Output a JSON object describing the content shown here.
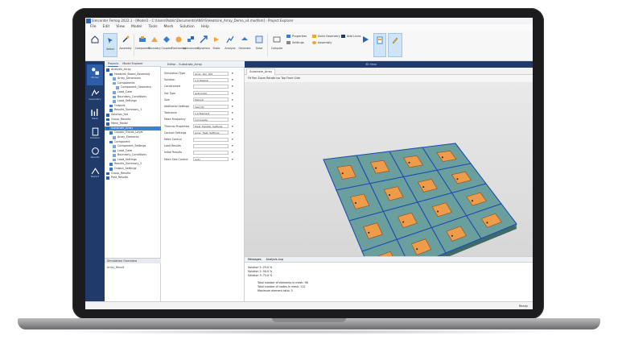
{
  "app": {
    "title": "Simcenter Femap 2022.1 - [Model1 - C:\\Users\\Public\\Documents\\ANSYS\\Heatsink_Array_Demo_v4.modfem] - Project Explorer",
    "menu": [
      "File",
      "Edit",
      "View",
      "Model",
      "Tools",
      "Mesh",
      "Solution",
      "Help"
    ]
  },
  "ribbon": {
    "buttons": [
      "Select",
      "Assembly",
      "Component",
      "Boundary",
      "Coupled",
      "Electromag",
      "Interconnect",
      "Dynamics",
      "Static",
      "Analysis",
      "Generate",
      "Solve",
      "Compute"
    ],
    "small_items": [
      "Properties",
      "Solid Geometry",
      "Add Lines",
      "Settings",
      "Assembly"
    ],
    "highlight": "#cfe4f7"
  },
  "left_nav": {
    "items": [
      "Model",
      "Geometry",
      "Mesh",
      "Solution",
      "Results",
      "Report"
    ]
  },
  "model_panel": {
    "tabs": [
      "Projects",
      "Model Explorer"
    ],
    "tree": [
      {
        "label": "Analysis_Array",
        "indent": 0
      },
      {
        "label": "Heatsink_Board_Assembly",
        "indent": 1
      },
      {
        "label": "Array_Dimension",
        "indent": 2
      },
      {
        "label": "Components",
        "indent": 2
      },
      {
        "label": "Component_Geometry",
        "indent": 3
      },
      {
        "label": "Load_Case",
        "indent": 2
      },
      {
        "label": "Boundary_Conditions",
        "indent": 2
      },
      {
        "label": "Load_Settings",
        "indent": 2
      },
      {
        "label": "Outputs",
        "indent": 1
      },
      {
        "label": "Results_Summary_1",
        "indent": 1
      },
      {
        "label": "Solution_Set",
        "indent": 0
      },
      {
        "label": "Group_Results",
        "indent": 0
      },
      {
        "label": "Mesh_Model",
        "indent": 0
      },
      {
        "label": "Substrate_Array",
        "indent": 0,
        "selected": true
      },
      {
        "label": "Copper_Traces_Layer",
        "indent": 1
      },
      {
        "label": "Array_Elements",
        "indent": 2
      },
      {
        "label": "Component",
        "indent": 1
      },
      {
        "label": "Component_Settings",
        "indent": 2
      },
      {
        "label": "Load_Case",
        "indent": 2
      },
      {
        "label": "Boundary_Conditions",
        "indent": 2
      },
      {
        "label": "Load_Settings",
        "indent": 2
      },
      {
        "label": "Results_Summary_2",
        "indent": 1
      },
      {
        "label": "Output_Settings",
        "indent": 1
      },
      {
        "label": "Group_Results",
        "indent": 0
      },
      {
        "label": "Post_Results",
        "indent": 0
      }
    ],
    "selection_header": "Simulation Overview",
    "selection_item": "Array_Result"
  },
  "property_panel": {
    "title": "Editor - Substrate_Array",
    "rows": [
      {
        "k": "Simulation Type",
        "v": "Array_Sim_001"
      },
      {
        "k": "Solution",
        "v": "1.0 Statical"
      },
      {
        "k": "Constrained",
        "v": ""
      },
      {
        "k": "Set Type",
        "v": "Automatic"
      },
      {
        "k": "Size",
        "v": "Manual"
      },
      {
        "k": "Additional Settings",
        "v": "Velocity"
      },
      {
        "k": "Tolerance",
        "v": "1.0 Element"
      },
      {
        "k": "Mesh Frequency",
        "v": "Composite"
      },
      {
        "k": "Thermal Properties",
        "v": "Heat_Transfer_Settings"
      },
      {
        "k": "Contact Settings",
        "v": "Array_Heat_Settings"
      },
      {
        "k": "Mesh Control",
        "v": ""
      },
      {
        "k": "Load Results",
        "v": ""
      },
      {
        "k": "Initial Results",
        "v": ""
      },
      {
        "k": "Mesh Size Control",
        "v": "Auto"
      }
    ],
    "footer": "Show Advanced Settings"
  },
  "viewport": {
    "header_label": "3D View",
    "tab": "Substrate_Array",
    "toolbar": "Fit  Pan  Zoom  Rotate  Iso  Top  Front  Side"
  },
  "results_panel": {
    "tabs": [
      "Messages",
      "Analysis Log"
    ],
    "lines": [
      "Solution 1: 25.0 %",
      "Solution 2: 50.0 %",
      "Solution 3: 75.0 %",
      "Total number of elements in mesh: 96",
      "Total number of nodes in mesh: 112",
      "Maximum element ratio: 5"
    ]
  },
  "status": {
    "right": "Ready"
  },
  "grid": {
    "rows": 4,
    "cols": 4
  }
}
